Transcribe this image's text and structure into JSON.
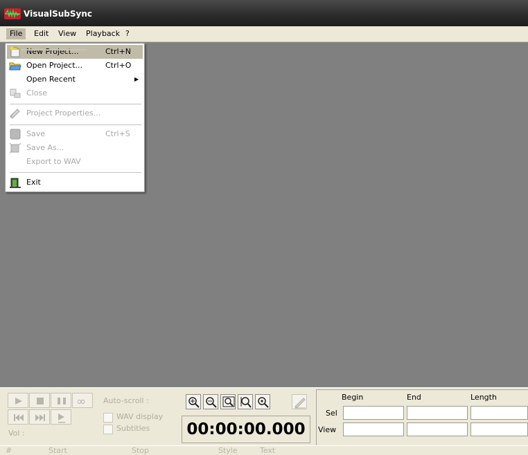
{
  "window": {
    "title": "VisualSubSync"
  },
  "menubar": {
    "items": [
      {
        "label": "File"
      },
      {
        "label": "Edit"
      },
      {
        "label": "View"
      },
      {
        "label": "Playback"
      },
      {
        "label": "?"
      }
    ]
  },
  "file_menu": {
    "items": [
      {
        "label": "New Project...",
        "shortcut": "Ctrl+N",
        "icon": "new-project-icon",
        "enabled": true,
        "highlighted": true
      },
      {
        "label": "Open Project...",
        "shortcut": "Ctrl+O",
        "icon": "open-project-icon",
        "enabled": true
      },
      {
        "label": "Open Recent",
        "shortcut": "",
        "submenu": true,
        "enabled": true
      },
      {
        "label": "Close",
        "shortcut": "",
        "icon": "close-project-icon",
        "enabled": false
      },
      {
        "label": "Project Properties...",
        "shortcut": "",
        "icon": "properties-icon",
        "enabled": false
      },
      {
        "label": "Save",
        "shortcut": "Ctrl+S",
        "icon": "save-icon",
        "enabled": false
      },
      {
        "label": "Save As...",
        "shortcut": "",
        "icon": "save-as-icon",
        "enabled": false
      },
      {
        "label": "Export to WAV",
        "shortcut": "",
        "enabled": false
      },
      {
        "label": "Exit",
        "shortcut": "",
        "icon": "exit-icon",
        "enabled": true
      }
    ]
  },
  "player": {
    "autoscroll_label": "Auto-scroll :",
    "wav_display_label": "WAV display",
    "subtitles_label": "Subtitles",
    "vol_label": "Vol :",
    "time": "00:00:00.000"
  },
  "selection_grid": {
    "headers": [
      "Begin",
      "End",
      "Length"
    ],
    "rows": [
      {
        "label": "Sel",
        "values": [
          "",
          "",
          ""
        ]
      },
      {
        "label": "View",
        "values": [
          "",
          "",
          ""
        ]
      }
    ]
  },
  "subtitle_columns": [
    "#",
    "Start",
    "Stop",
    "Style",
    "Text"
  ],
  "colors": {
    "title_bar": "#2b2b2b",
    "menu_bar": "#ece9d8",
    "workspace": "#808080",
    "highlight": "#c0bba8"
  }
}
